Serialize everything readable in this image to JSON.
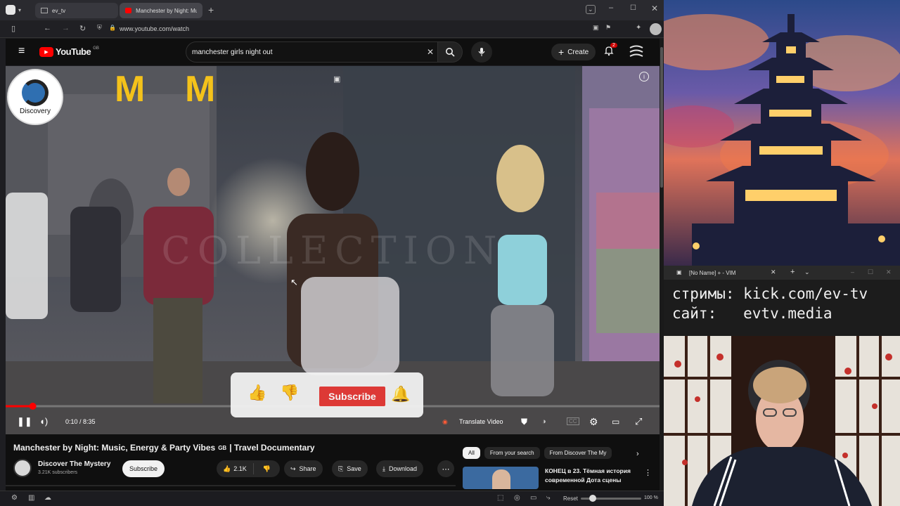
{
  "browser": {
    "tabs": [
      {
        "label": "ev_tv"
      },
      {
        "label": "Manchester by Night: Musi"
      }
    ],
    "url": "www.youtube.com/watch",
    "zoom": "100 %",
    "reset_label": "Reset"
  },
  "youtube": {
    "logo": "YouTube",
    "region": "GB",
    "search_value": "manchester girls night out",
    "create_label": "Create",
    "notification_count": "2"
  },
  "player": {
    "channel_logo_text": "Discovery",
    "watermark": "COLLECTION",
    "time": "0:10 / 8:35",
    "progress_fraction": 0.02,
    "translate_label": "Translate Video",
    "overlay_subscribe": "Subscribe"
  },
  "video_info": {
    "title": "Manchester by Night: Music, Energy & Party Vibes",
    "title_flag": "GB",
    "title_suffix": "| Travel Documentary",
    "channel": "Discover The Mystery",
    "subscribers": "3.21K subscribers",
    "subscribe": "Subscribe",
    "likes": "2.1K",
    "share": "Share",
    "save": "Save",
    "download": "Download"
  },
  "chips": [
    {
      "label": "All",
      "active": true
    },
    {
      "label": "From your search",
      "active": false
    },
    {
      "label": "From Discover The My",
      "active": false
    }
  ],
  "suggestion": {
    "title_line1": "КОНЕЦ в 23. Тёмная история",
    "title_line2": "современной Дота сцены"
  },
  "vim": {
    "title": "[No Name] + - VIM",
    "line1": "стримы: kick.com/ev-tv",
    "line2": "сайт:   evtv.media"
  },
  "colors": {
    "accent_red": "#ff0000",
    "subscribe_red": "#e53935",
    "yt_bg": "#0f0f0f"
  }
}
